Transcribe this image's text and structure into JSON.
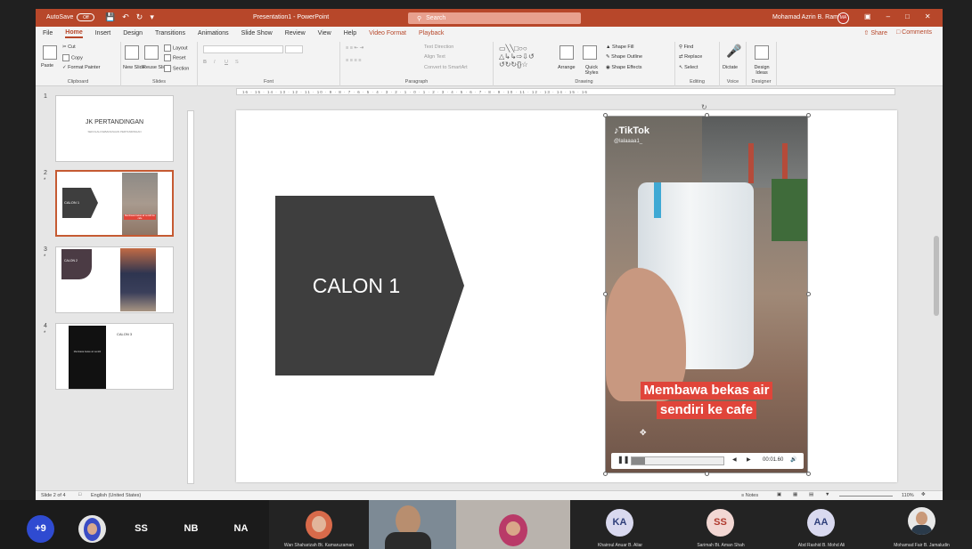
{
  "titlebar": {
    "autosave_label": "AutoSave",
    "autosave_state": "Off",
    "doc_title": "Presentation1 - PowerPoint",
    "search_placeholder": "Search",
    "user_name": "Mohamad Azrin B. Ramli",
    "user_initials": "MA"
  },
  "tabs": [
    "File",
    "Home",
    "Insert",
    "Design",
    "Transitions",
    "Animations",
    "Slide Show",
    "Review",
    "View",
    "Help",
    "Video Format",
    "Playback"
  ],
  "tab_active": "Home",
  "tab_share": "Share",
  "tab_comments": "Comments",
  "ribbon": {
    "clipboard": {
      "label": "Clipboard",
      "paste": "Paste",
      "cut": "Cut",
      "copy": "Copy",
      "format_painter": "Format Painter"
    },
    "slides": {
      "label": "Slides",
      "new_slide": "New Slide",
      "reuse_slides": "Reuse Slides",
      "layout": "Layout",
      "reset": "Reset",
      "section": "Section"
    },
    "font": {
      "label": "Font",
      "bold": "B",
      "italic": "I",
      "underline": "U",
      "strike": "S"
    },
    "paragraph": {
      "label": "Paragraph",
      "text_direction": "Text Direction",
      "align_text": "Align Text",
      "smartart": "Convert to SmartArt"
    },
    "drawing": {
      "label": "Drawing",
      "arrange": "Arrange",
      "quick_styles": "Quick Styles",
      "shape_fill": "Shape Fill",
      "shape_outline": "Shape Outline",
      "shape_effects": "Shape Effects"
    },
    "editing": {
      "label": "Editing",
      "find": "Find",
      "replace": "Replace",
      "select": "Select"
    },
    "voice": {
      "label": "Voice",
      "dictate": "Dictate"
    },
    "designer": {
      "label": "Designer",
      "design_ideas": "Design Ideas"
    }
  },
  "ruler_text": "16 · 15 · 14 · 13 · 12 · 11 · 10 · 9 · 8 · 7 · 6 · 5 · 4 · 3 · 2 · 1 · 0 · 1 · 2 · 3 · 4 · 5 · 6 · 7 · 8 · 9 · 10 · 11 · 12 · 13 · 14 · 15 · 16",
  "thumbnails": [
    {
      "num": "1",
      "title": "JK PERTANDINGAN",
      "subtitle": "SEKOLAH KEBANGSAAN PERTANDINGAN"
    },
    {
      "num": "2",
      "label": "CALON 1",
      "caption": "Membawa bekas air sendiri ke cafe"
    },
    {
      "num": "3",
      "label": "CALON 2"
    },
    {
      "num": "4",
      "label": "CALON 3",
      "caption": "Membawa bekas air sendiri"
    }
  ],
  "slide": {
    "shape_label": "CALON 1",
    "video": {
      "brand": "TikTok",
      "handle": "@lalaaaa1_",
      "caption_line1": "Membawa bekas air",
      "caption_line2": "sendiri ke cafe",
      "time": "00:01.60",
      "progress_fraction": 0.15
    }
  },
  "status": {
    "slide_count": "Slide 2 of 4",
    "language": "English (United States)",
    "notes": "Notes",
    "zoom": "110%"
  },
  "participants": {
    "overflow": "+9",
    "circles": [
      {
        "initials": "SS",
        "color": "#e0776b"
      },
      {
        "initials": "NB",
        "color": "#e0776b"
      },
      {
        "initials": "NA",
        "color": "#e0776b"
      }
    ],
    "tiles": [
      {
        "name": "Wan Shaharizah Bt. Kamaruzaman"
      },
      {
        "name": ""
      },
      {
        "name": ""
      },
      {
        "name": "Khairoul Anuar B. Aliar",
        "initials": "KA",
        "color": "#d9d9ef"
      },
      {
        "name": "Sarimah Bt. Aman Shah",
        "initials": "SS",
        "color": "#f2d7d3"
      },
      {
        "name": "Abd Rashid B. Mohd Ali",
        "initials": "AA",
        "color": "#d9d9ef"
      },
      {
        "name": "Mohamad Fair B. Jamaludin"
      }
    ]
  }
}
